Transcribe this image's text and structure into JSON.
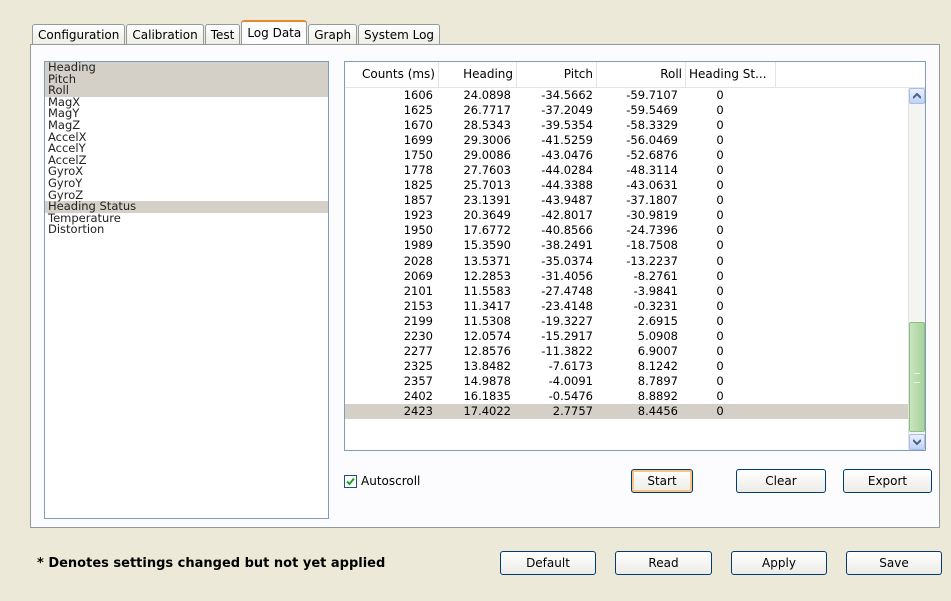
{
  "tabs": [
    {
      "label": "Configuration",
      "active": false
    },
    {
      "label": "Calibration",
      "active": false
    },
    {
      "label": "Test",
      "active": false
    },
    {
      "label": "Log Data",
      "active": true
    },
    {
      "label": "Graph",
      "active": false
    },
    {
      "label": "System Log",
      "active": false
    }
  ],
  "channels": [
    {
      "label": "Heading",
      "selected": true
    },
    {
      "label": "Pitch",
      "selected": true
    },
    {
      "label": "Roll",
      "selected": true
    },
    {
      "label": "MagX",
      "selected": false
    },
    {
      "label": "MagY",
      "selected": false
    },
    {
      "label": "MagZ",
      "selected": false
    },
    {
      "label": "AccelX",
      "selected": false
    },
    {
      "label": "AccelY",
      "selected": false
    },
    {
      "label": "AccelZ",
      "selected": false
    },
    {
      "label": "GyroX",
      "selected": false
    },
    {
      "label": "GyroY",
      "selected": false
    },
    {
      "label": "GyroZ",
      "selected": false
    },
    {
      "label": "Heading Status",
      "selected": true
    },
    {
      "label": "Temperature",
      "selected": false
    },
    {
      "label": "Distortion",
      "selected": false
    }
  ],
  "grid": {
    "columns": [
      "Counts (ms)",
      "Heading",
      "Pitch",
      "Roll",
      "Heading St..."
    ],
    "rows": [
      [
        "1606",
        "24.0898",
        "-34.5662",
        "-59.7107",
        "0"
      ],
      [
        "1625",
        "26.7717",
        "-37.2049",
        "-59.5469",
        "0"
      ],
      [
        "1670",
        "28.5343",
        "-39.5354",
        "-58.3329",
        "0"
      ],
      [
        "1699",
        "29.3006",
        "-41.5259",
        "-56.0469",
        "0"
      ],
      [
        "1750",
        "29.0086",
        "-43.0476",
        "-52.6876",
        "0"
      ],
      [
        "1778",
        "27.7603",
        "-44.0284",
        "-48.3114",
        "0"
      ],
      [
        "1825",
        "25.7013",
        "-44.3388",
        "-43.0631",
        "0"
      ],
      [
        "1857",
        "23.1391",
        "-43.9487",
        "-37.1807",
        "0"
      ],
      [
        "1923",
        "20.3649",
        "-42.8017",
        "-30.9819",
        "0"
      ],
      [
        "1950",
        "17.6772",
        "-40.8566",
        "-24.7396",
        "0"
      ],
      [
        "1989",
        "15.3590",
        "-38.2491",
        "-18.7508",
        "0"
      ],
      [
        "2028",
        "13.5371",
        "-35.0374",
        "-13.2237",
        "0"
      ],
      [
        "2069",
        "12.2853",
        "-31.4056",
        "-8.2761",
        "0"
      ],
      [
        "2101",
        "11.5583",
        "-27.4748",
        "-3.9841",
        "0"
      ],
      [
        "2153",
        "11.3417",
        "-23.4148",
        "-0.3231",
        "0"
      ],
      [
        "2199",
        "11.5308",
        "-19.3227",
        "2.6915",
        "0"
      ],
      [
        "2230",
        "12.0574",
        "-15.2917",
        "5.0908",
        "0"
      ],
      [
        "2277",
        "12.8576",
        "-11.3822",
        "6.9007",
        "0"
      ],
      [
        "2325",
        "13.8482",
        "-7.6173",
        "8.1242",
        "0"
      ],
      [
        "2357",
        "14.9878",
        "-4.0091",
        "8.7897",
        "0"
      ],
      [
        "2402",
        "16.1835",
        "-0.5476",
        "8.8892",
        "0"
      ],
      [
        "2423",
        "17.4022",
        "2.7757",
        "8.4456",
        "0"
      ]
    ],
    "selected_row": 21
  },
  "autoscroll": {
    "label": "Autoscroll",
    "checked": true
  },
  "log_buttons": {
    "start": "Start",
    "clear": "Clear",
    "export": "Export"
  },
  "bottom_buttons": {
    "default": "Default",
    "read": "Read",
    "apply": "Apply",
    "save": "Save"
  },
  "note": "* Denotes settings changed but not yet applied",
  "colors": {
    "window_bg": "#ece9d8",
    "active_tab_accent": "#e68b2c",
    "selection": "#d4d0c8",
    "scroll_thumb": "#a7d39b"
  }
}
